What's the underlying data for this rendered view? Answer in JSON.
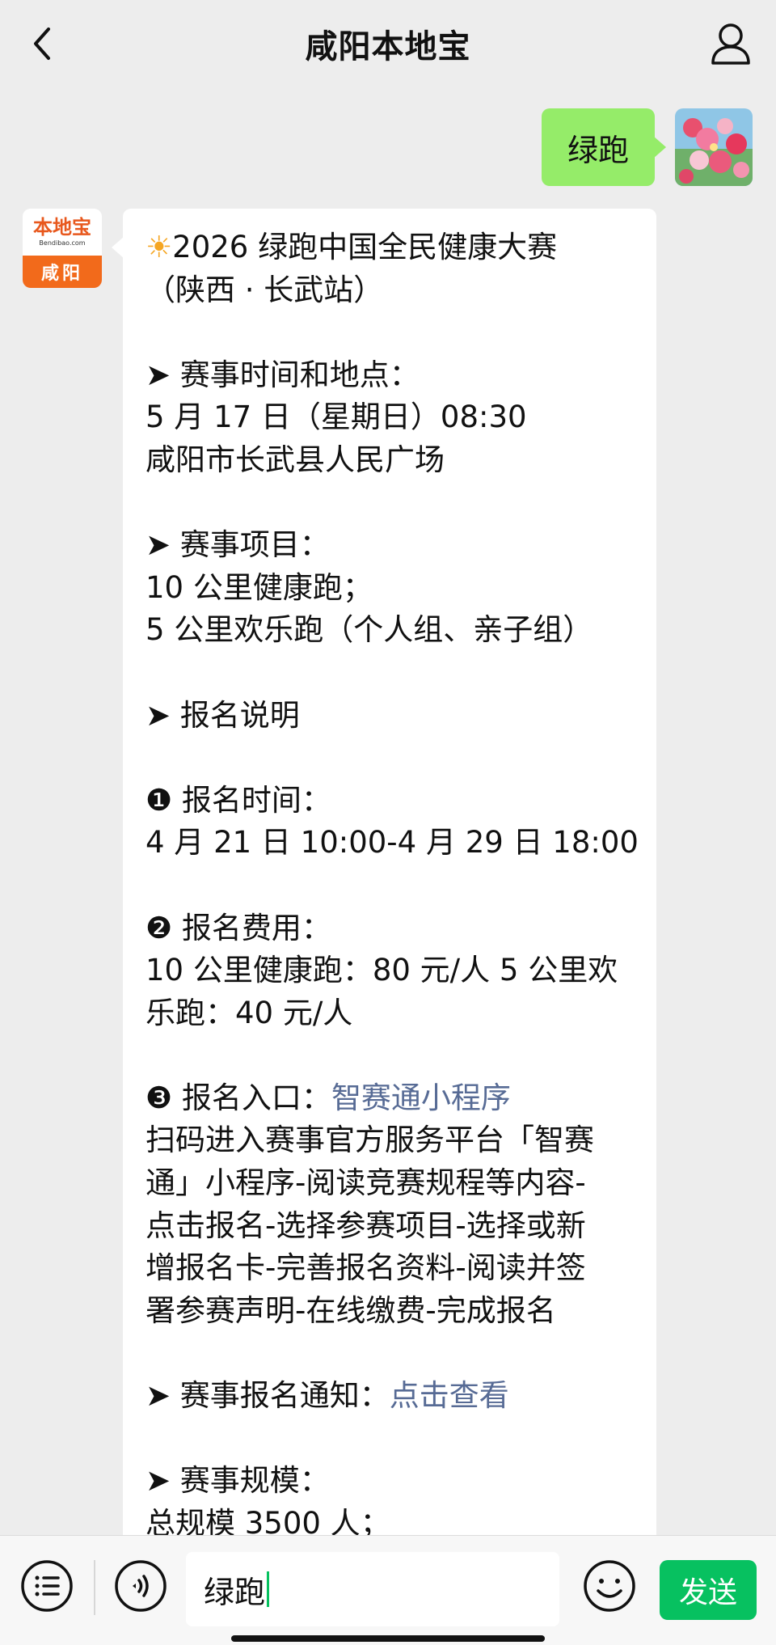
{
  "header": {
    "title": "咸阳本地宝",
    "back_icon": "chevron-left-icon",
    "user_icon": "user-profile-icon"
  },
  "outgoing": {
    "text": "绿跑",
    "avatar": "flower-avatar"
  },
  "incoming": {
    "avatar_logo": "本地宝",
    "avatar_logo_sub": "Bendibao.com",
    "avatar_city": "咸阳",
    "lines": [
      "2026 绿跑中国全民健康大赛",
      "（陕西 · 长武站）",
      "",
      "➤ 赛事时间和地点：",
      "5 月 17 日（星期日）08:30",
      "咸阳市长武县人民广场",
      "",
      "➤ 赛事项目：",
      "10 公里健康跑；",
      "5 公里欢乐跑（个人组、亲子组）",
      "",
      "➤ 报名说明",
      "",
      "❶ 报名时间：",
      "4 月 21 日 10:00-4 月 29 日 18:00",
      "",
      "❷ 报名费用：",
      "10 公里健康跑：80 元/人 5 公里欢",
      "乐跑：40 元/人",
      "",
      "❸ 报名入口：",
      "扫码进入赛事官方服务平台「智赛",
      "通」小程序-阅读竞赛规程等内容-",
      "点击报名-选择参赛项目-选择或新",
      "增报名卡-完善报名资料-阅读并签",
      "署参赛声明-在线缴费-完成报名",
      "",
      "➤ 赛事报名通知：",
      "",
      "➤ 赛事规模：",
      "总规模 3500 人；"
    ],
    "sun_emoji": "☀",
    "link_entry": "智赛通小程序",
    "link_notice": "点击查看"
  },
  "bottom": {
    "menu_icon": "menu-list-icon",
    "voice_icon": "voice-icon",
    "input_value": "绿跑",
    "emoji_icon": "emoji-icon",
    "send_label": "发送"
  },
  "colors": {
    "bubble_out": "#95ec69",
    "link": "#576b95",
    "send": "#07c160",
    "background": "#ededed"
  }
}
